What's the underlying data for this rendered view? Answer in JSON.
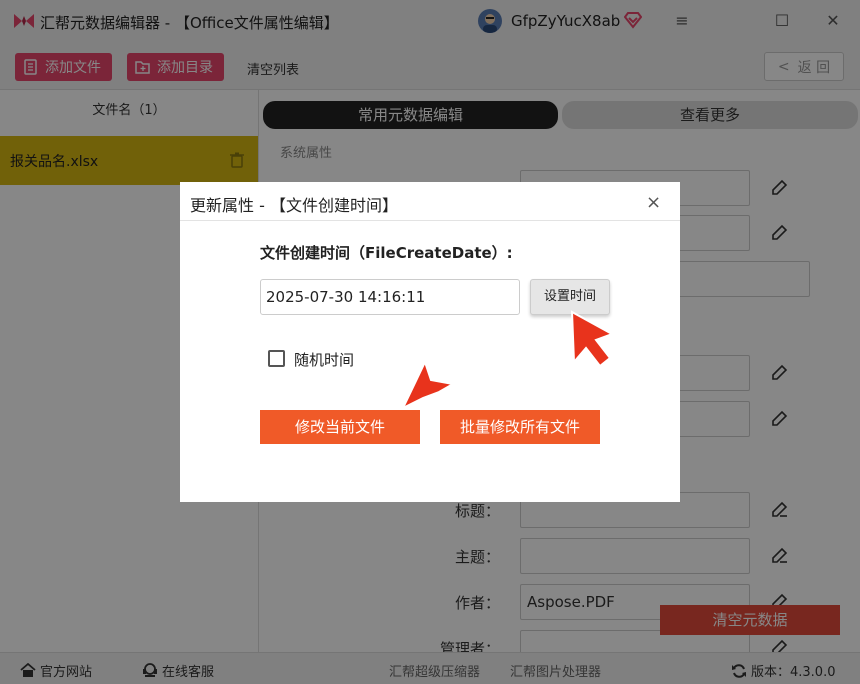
{
  "titlebar": {
    "title": "汇帮元数据编辑器 - 【Office文件属性编辑】",
    "username": "GfpZyYucX8ab",
    "win_menu": "≡",
    "win_max": "☐",
    "win_close": "✕"
  },
  "toolbar": {
    "add_file": "添加文件",
    "add_dir": "添加目录",
    "clear_list": "清空列表",
    "back": "返 回",
    "back_chevron": "<"
  },
  "sidebar": {
    "header": "文件名（1）",
    "files": [
      {
        "name": "报关品名.xlsx"
      }
    ]
  },
  "main": {
    "tabs": [
      {
        "label": "常用元数据编辑"
      },
      {
        "label": "查看更多"
      }
    ],
    "section_system": "系统属性",
    "fields": [
      {
        "label": "标题：",
        "value": ""
      },
      {
        "label": "主题：",
        "value": ""
      },
      {
        "label": "作者：",
        "value": "Aspose.PDF"
      },
      {
        "label": "管理者：",
        "value": ""
      }
    ],
    "clear_meta": "清空元数据"
  },
  "dialog": {
    "title": "更新属性 - 【文件创建时间】",
    "close": "×",
    "field_label": "文件创建时间（FileCreateDate）:",
    "value": "2025-07-30 14:16:11",
    "set_time": "设置时间",
    "random_time": "随机时间",
    "random_checked": false,
    "modify_current": "修改当前文件",
    "modify_all": "批量修改所有文件"
  },
  "statusbar": {
    "official_site": "官方网站",
    "online_service": "在线客服",
    "compress_link": "汇帮超级压缩器",
    "image_link": "汇帮图片处理器",
    "version": "版本：4.3.0.0"
  },
  "colors": {
    "toolbar_button": "#e8466c",
    "selected_file": "#d6b712",
    "primary_action": "#f05a28",
    "arrow": "#e8331c"
  }
}
